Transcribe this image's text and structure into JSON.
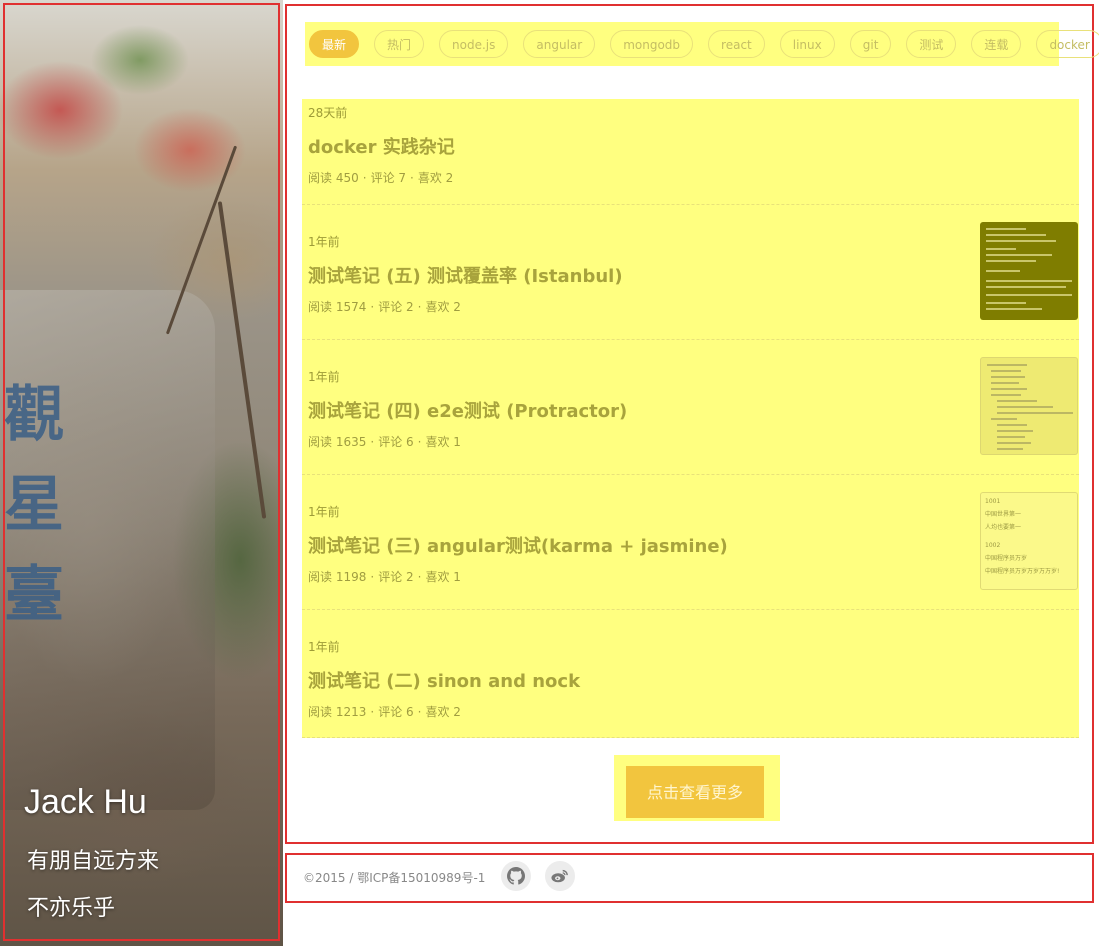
{
  "sidebar": {
    "name": "Jack Hu",
    "motto_line1": "有朋自远方来",
    "motto_line2": "不亦乐乎",
    "photo_icon": "landscape-photo"
  },
  "tags": {
    "items": [
      "最新",
      "热门",
      "node.js",
      "angular",
      "mongodb",
      "react",
      "linux",
      "git",
      "测试",
      "连载",
      "docker"
    ],
    "active_index": 0
  },
  "articles": [
    {
      "time": "28天前",
      "title": "docker 实践杂记",
      "read": "阅读 450",
      "comments": "评论 7",
      "likes": "喜欢 2",
      "thumb": "none"
    },
    {
      "time": "1年前",
      "title": "测试笔记 (五) 测试覆盖率 (Istanbul)",
      "read": "阅读 1574",
      "comments": "评论 2",
      "likes": "喜欢 2",
      "thumb": "coverage-report-thumbnail"
    },
    {
      "time": "1年前",
      "title": "测试笔记 (四) e2e测试 (Protractor)",
      "read": "阅读 1635",
      "comments": "评论 6",
      "likes": "喜欢 1",
      "thumb": "file-tree-thumbnail"
    },
    {
      "time": "1年前",
      "title": "测试笔记 (三) angular测试(karma + jasmine)",
      "read": "阅读 1198",
      "comments": "评论 2",
      "likes": "喜欢 1",
      "thumb": "list-preview-thumbnail"
    },
    {
      "time": "1年前",
      "title": "测试笔记 (二) sinon and nock",
      "read": "阅读 1213",
      "comments": "评论 6",
      "likes": "喜欢 2",
      "thumb": "none"
    }
  ],
  "meta_separator": "·",
  "thumb_text": {
    "list_a": "1001",
    "list_a_line1": "中国世界第一",
    "list_a_line2": "人均也要第一",
    "list_b": "1002",
    "list_b_line1": "中国程序员万岁",
    "list_b_line2": "中国程序员万岁万岁万万岁!"
  },
  "load_more": "点击查看更多",
  "footer": {
    "copyright": "©2015 / 鄂ICP备15010989号-1",
    "icons": [
      "github-icon",
      "weibo-icon"
    ]
  },
  "colors": {
    "accent": "#f2c53e",
    "highlight": "#ffff80",
    "frame": "#e03030"
  }
}
